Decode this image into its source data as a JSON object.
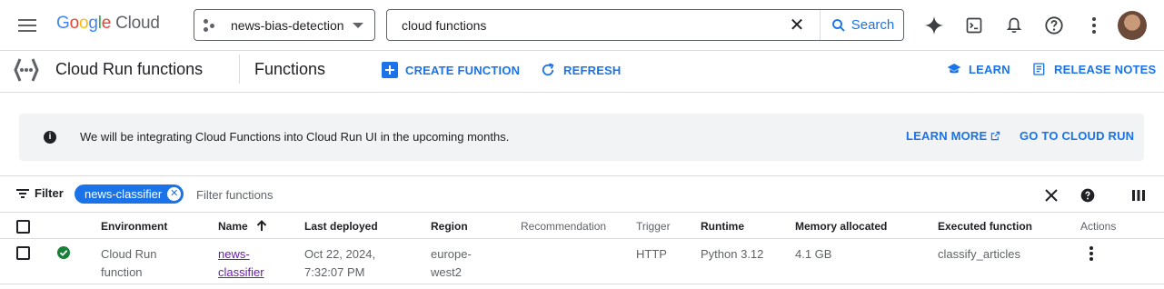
{
  "colors": {
    "accent": "#1a73e8",
    "status_ok": "#188038",
    "visited_link": "#681da8"
  },
  "topbar": {
    "logo_google": [
      "G",
      "o",
      "o",
      "g",
      "l",
      "e"
    ],
    "logo_cloud": "Cloud",
    "project": "news-bias-detection",
    "search_value": "cloud functions",
    "search_label": "Search",
    "icons": [
      "gemini-icon",
      "cloud-shell-icon",
      "notifications-icon",
      "help-icon",
      "more-vert-icon",
      "avatar"
    ]
  },
  "subheader": {
    "product": "Cloud Run functions",
    "page": "Functions",
    "create": "CREATE FUNCTION",
    "refresh": "REFRESH",
    "learn": "LEARN",
    "release_notes": "RELEASE NOTES"
  },
  "banner": {
    "message": "We will be integrating Cloud Functions into Cloud Run UI in the upcoming months.",
    "learn_more": "LEARN MORE",
    "go_to": "GO TO CLOUD RUN"
  },
  "filter": {
    "label": "Filter",
    "chip": "news-classifier",
    "placeholder": "Filter functions"
  },
  "table": {
    "headers": {
      "environment": "Environment",
      "name": "Name",
      "last_deployed": "Last deployed",
      "region": "Region",
      "recommendation": "Recommendation",
      "trigger": "Trigger",
      "runtime": "Runtime",
      "memory": "Memory allocated",
      "executed": "Executed function",
      "actions": "Actions"
    },
    "sort": {
      "column": "Name",
      "direction": "ascending"
    },
    "rows": [
      {
        "status": "ok",
        "environment": [
          "Cloud Run",
          "function"
        ],
        "name": [
          "news-",
          "classifier"
        ],
        "last_deployed": [
          "Oct 22, 2024,",
          "7:32:07 PM"
        ],
        "region": [
          "europe-",
          "west2"
        ],
        "recommendation": "",
        "trigger": "HTTP",
        "runtime": "Python 3.12",
        "memory": "4.1 GB",
        "executed": "classify_articles"
      }
    ]
  }
}
